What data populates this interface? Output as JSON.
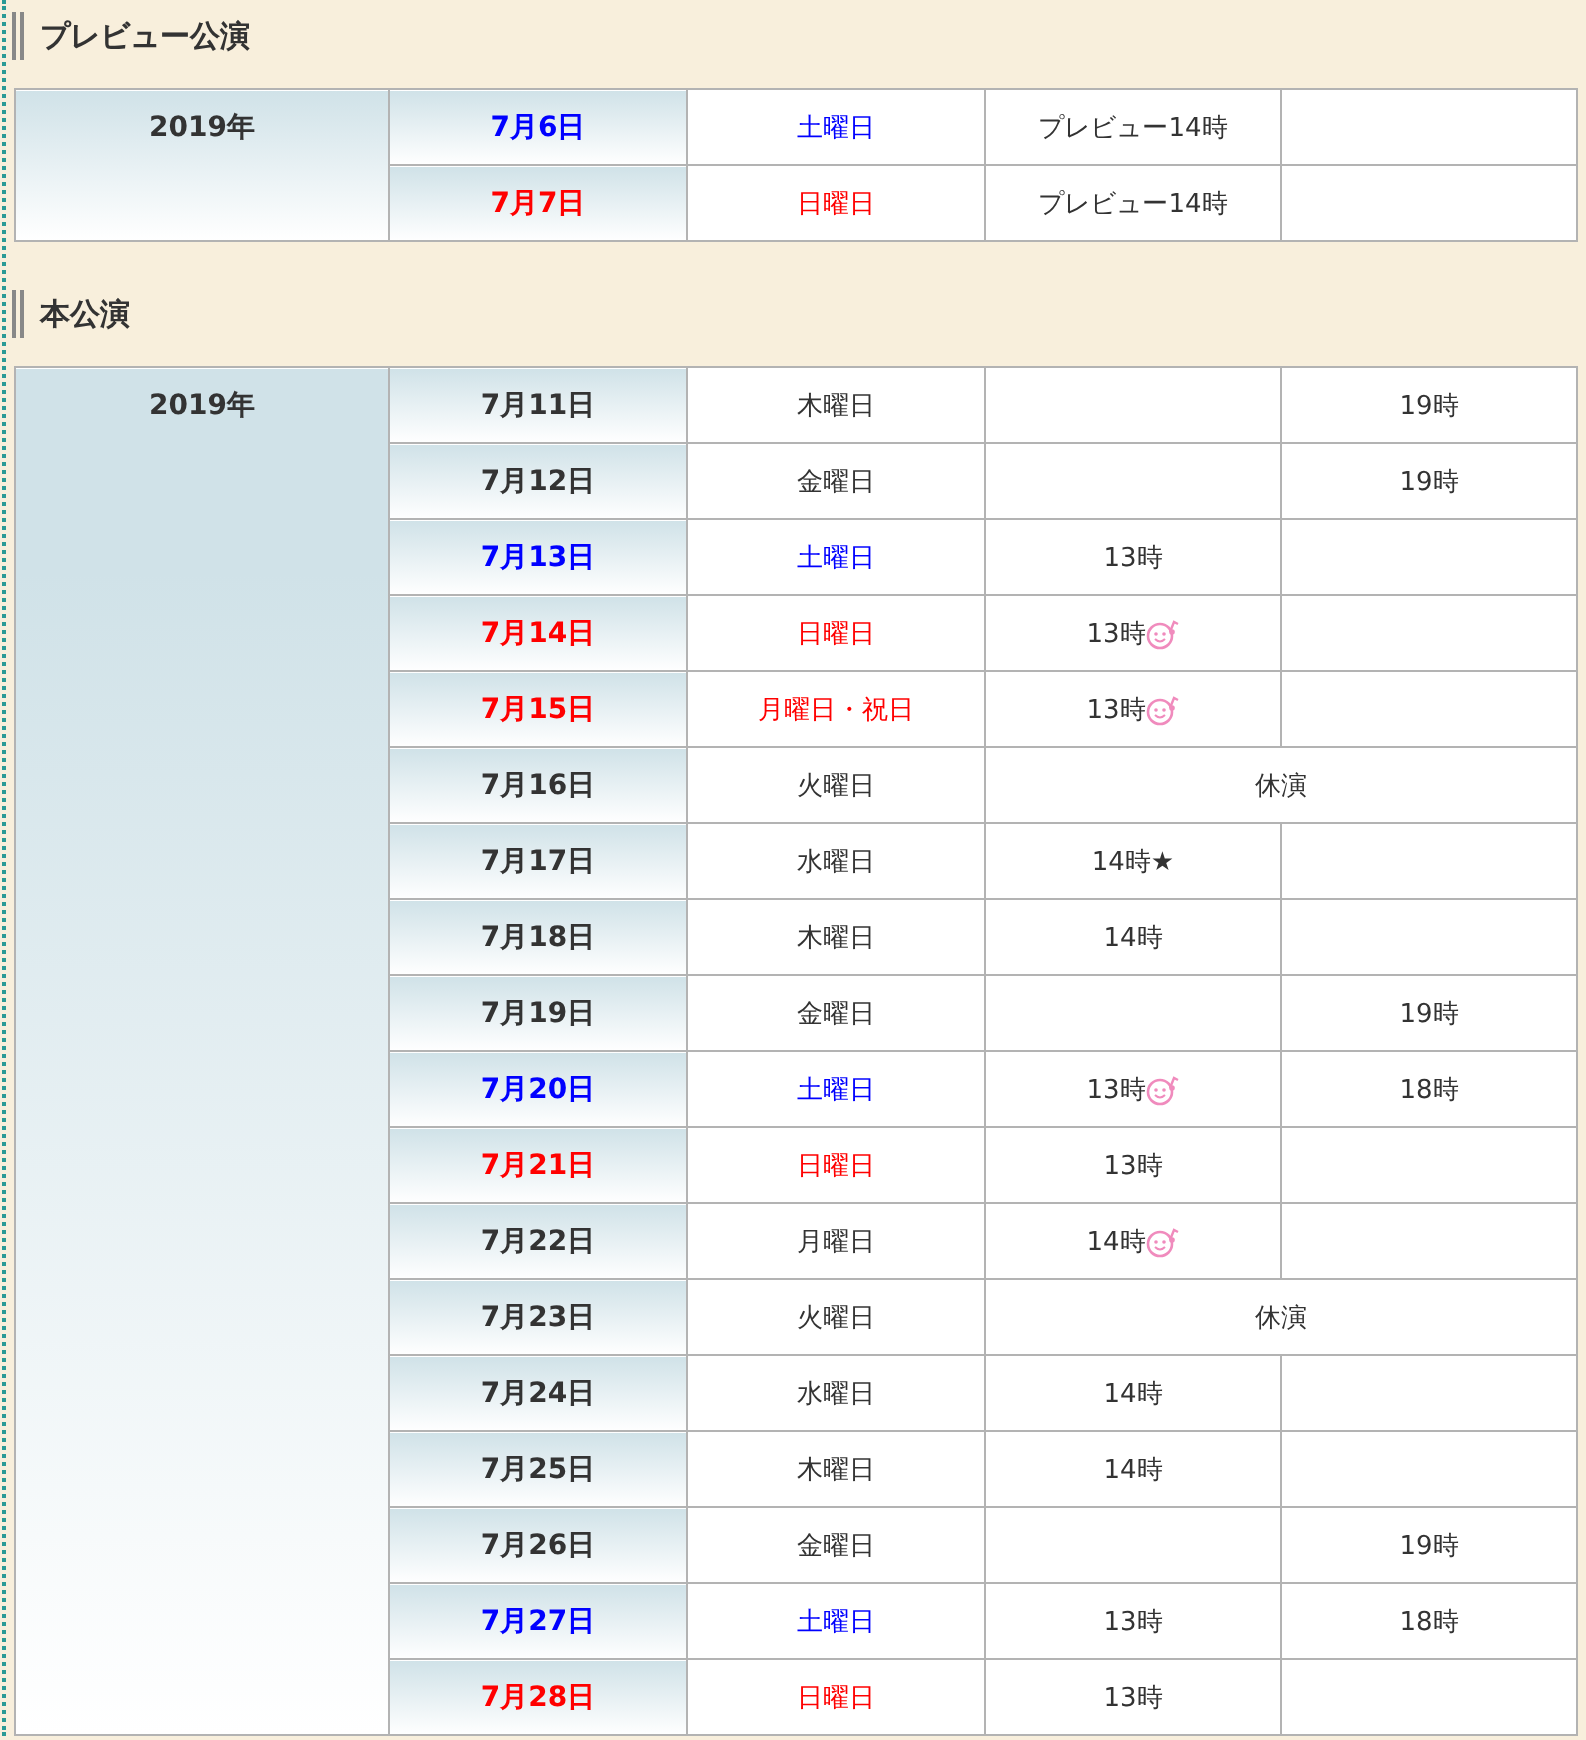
{
  "sections": [
    {
      "heading": "プレビュー公演",
      "year": "2019年",
      "rows": [
        {
          "kind": "performance",
          "date": "7月6日",
          "day": "土曜日",
          "color": "#0000ff",
          "matinee": "プレビュー14時",
          "matinee_mark": false
        },
        {
          "kind": "performance",
          "date": "7月7日",
          "day": "日曜日",
          "color": "#ff0000",
          "matinee": "プレビュー14時",
          "matinee_mark": false
        }
      ]
    },
    {
      "heading": "本公演",
      "year": "2019年",
      "rows": [
        {
          "kind": "performance",
          "date": "7月11日",
          "day": "木曜日",
          "color": "#333333",
          "evening": "19時",
          "matinee_mark": false
        },
        {
          "kind": "performance",
          "date": "7月12日",
          "day": "金曜日",
          "color": "#333333",
          "evening": "19時",
          "matinee_mark": false
        },
        {
          "kind": "performance",
          "date": "7月13日",
          "day": "土曜日",
          "color": "#0000ff",
          "matinee": "13時",
          "matinee_mark": false
        },
        {
          "kind": "performance",
          "date": "7月14日",
          "day": "日曜日",
          "color": "#ff0000",
          "matinee": "13時",
          "matinee_mark": true
        },
        {
          "kind": "performance",
          "date": "7月15日",
          "day": "月曜日・祝日",
          "color": "#ff0000",
          "matinee": "13時",
          "matinee_mark": true
        },
        {
          "kind": "closed",
          "date": "7月16日",
          "day": "火曜日",
          "color": "#333333",
          "note": "休演"
        },
        {
          "kind": "performance",
          "date": "7月17日",
          "day": "水曜日",
          "color": "#333333",
          "matinee": "14時★",
          "matinee_mark": false
        },
        {
          "kind": "performance",
          "date": "7月18日",
          "day": "木曜日",
          "color": "#333333",
          "matinee": "14時",
          "matinee_mark": false
        },
        {
          "kind": "performance",
          "date": "7月19日",
          "day": "金曜日",
          "color": "#333333",
          "evening": "19時",
          "matinee_mark": false
        },
        {
          "kind": "performance",
          "date": "7月20日",
          "day": "土曜日",
          "color": "#0000ff",
          "matinee": "13時",
          "matinee_mark": true,
          "evening": "18時"
        },
        {
          "kind": "performance",
          "date": "7月21日",
          "day": "日曜日",
          "color": "#ff0000",
          "matinee": "13時",
          "matinee_mark": false
        },
        {
          "kind": "performance",
          "date": "7月22日",
          "day": "月曜日",
          "color": "#333333",
          "matinee": "14時",
          "matinee_mark": true
        },
        {
          "kind": "closed",
          "date": "7月23日",
          "day": "火曜日",
          "color": "#333333",
          "note": "休演"
        },
        {
          "kind": "performance",
          "date": "7月24日",
          "day": "水曜日",
          "color": "#333333",
          "matinee": "14時",
          "matinee_mark": false
        },
        {
          "kind": "performance",
          "date": "7月25日",
          "day": "木曜日",
          "color": "#333333",
          "matinee": "14時",
          "matinee_mark": false
        },
        {
          "kind": "performance",
          "date": "7月26日",
          "day": "金曜日",
          "color": "#333333",
          "evening": "19時",
          "matinee_mark": false
        },
        {
          "kind": "performance",
          "date": "7月27日",
          "day": "土曜日",
          "color": "#0000ff",
          "matinee": "13時",
          "matinee_mark": false,
          "evening": "18時"
        },
        {
          "kind": "performance",
          "date": "7月28日",
          "day": "日曜日",
          "color": "#ff0000",
          "matinee": "13時",
          "matinee_mark": false
        }
      ]
    }
  ]
}
